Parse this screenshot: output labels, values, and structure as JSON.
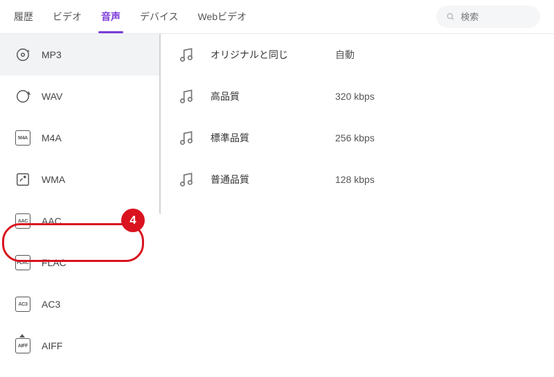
{
  "tabs": {
    "items": [
      "履歴",
      "ビデオ",
      "音声",
      "デバイス",
      "Webビデオ"
    ],
    "activeIndex": 2
  },
  "search": {
    "placeholder": "検索"
  },
  "sidebar": {
    "items": [
      {
        "label": "MP3",
        "icon": "mp3-icon",
        "selected": true
      },
      {
        "label": "WAV",
        "icon": "wav-icon"
      },
      {
        "label": "M4A",
        "icon": "m4a-icon",
        "box": "M4A"
      },
      {
        "label": "WMA",
        "icon": "wma-icon"
      },
      {
        "label": "AAC",
        "icon": "aac-icon",
        "box": "AAC"
      },
      {
        "label": "FLAC",
        "icon": "flac-icon",
        "box": "FLAC"
      },
      {
        "label": "AC3",
        "icon": "ac3-icon",
        "box": "AC3"
      },
      {
        "label": "AIFF",
        "icon": "aiff-icon",
        "box": "AIFF",
        "arrow": true
      }
    ]
  },
  "qualities": [
    {
      "name": "オリジナルと同じ",
      "rate": "自動"
    },
    {
      "name": "高品質",
      "rate": "320 kbps"
    },
    {
      "name": "標準品質",
      "rate": "256 kbps"
    },
    {
      "name": "普通品質",
      "rate": "128 kbps"
    }
  ],
  "annotation": {
    "number": "4"
  }
}
